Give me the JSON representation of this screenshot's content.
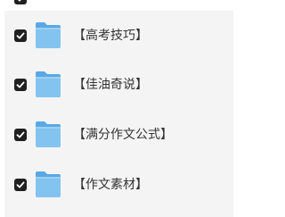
{
  "colors": {
    "panel_bg": "#f4f4f4",
    "checkbox_fill": "#202020",
    "checkmark": "#ffffff",
    "folder_main": "#83c3ef",
    "folder_tab": "#5aa8e4",
    "label_text": "#333333"
  },
  "folders": {
    "items": [
      {
        "label": "【高考技巧】",
        "checked": true,
        "icon": "folder-icon"
      },
      {
        "label": "【佳油奇说】",
        "checked": true,
        "icon": "folder-icon"
      },
      {
        "label": "【满分作文公式】",
        "checked": true,
        "icon": "folder-icon"
      },
      {
        "label": "【作文素材】",
        "checked": true,
        "icon": "folder-icon"
      }
    ]
  }
}
